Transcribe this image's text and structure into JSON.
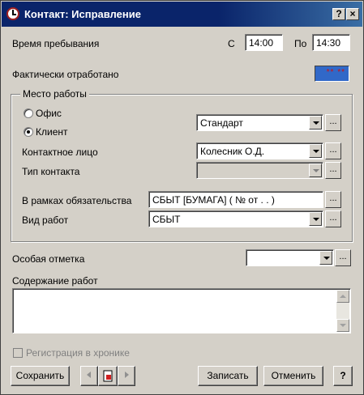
{
  "window": {
    "title": "Контакт: Исправление",
    "help_label": "?",
    "close_label": "×"
  },
  "time": {
    "label": "Время пребывания",
    "from_label": "С",
    "from_value": "14:00",
    "to_label": "По",
    "to_value": "14:30"
  },
  "worked": {
    "label": "Фактически отработано",
    "value": "** **"
  },
  "workplace": {
    "group_title": "Место работы",
    "office_label": "Офис",
    "client_label": "Клиент",
    "selected": "Клиент",
    "type_value": "Стандарт",
    "contact_person_label": "Контактное лицо",
    "contact_person_value": "Колесник О.Д.",
    "contact_type_label": "Тип контакта",
    "contact_type_value": "",
    "obligation_label": "В рамках обязательства",
    "obligation_value": "СБЫТ [БУМАГА] ( №  от  .  .   )",
    "work_type_label": "Вид работ",
    "work_type_value": "СБЫТ"
  },
  "special_mark": {
    "label": "Особая отметка",
    "value": ""
  },
  "content": {
    "label": "Содержание работ",
    "value": ""
  },
  "chronicle": {
    "label": "Регистрация в хронике",
    "checked": false,
    "enabled": false
  },
  "dots_label": "...",
  "footer": {
    "save_label": "Сохранить",
    "record_label": "Записать",
    "cancel_label": "Отменить",
    "help_label": "?"
  },
  "nav": {
    "prev_icon": "triangle-left-icon",
    "doc_icon": "document-icon",
    "next_icon": "triangle-right-icon"
  },
  "colors": {
    "titlebar": "#0a246a",
    "face": "#d4d0c8",
    "worked_field": "#3168c8",
    "worked_text": "#d01010"
  }
}
